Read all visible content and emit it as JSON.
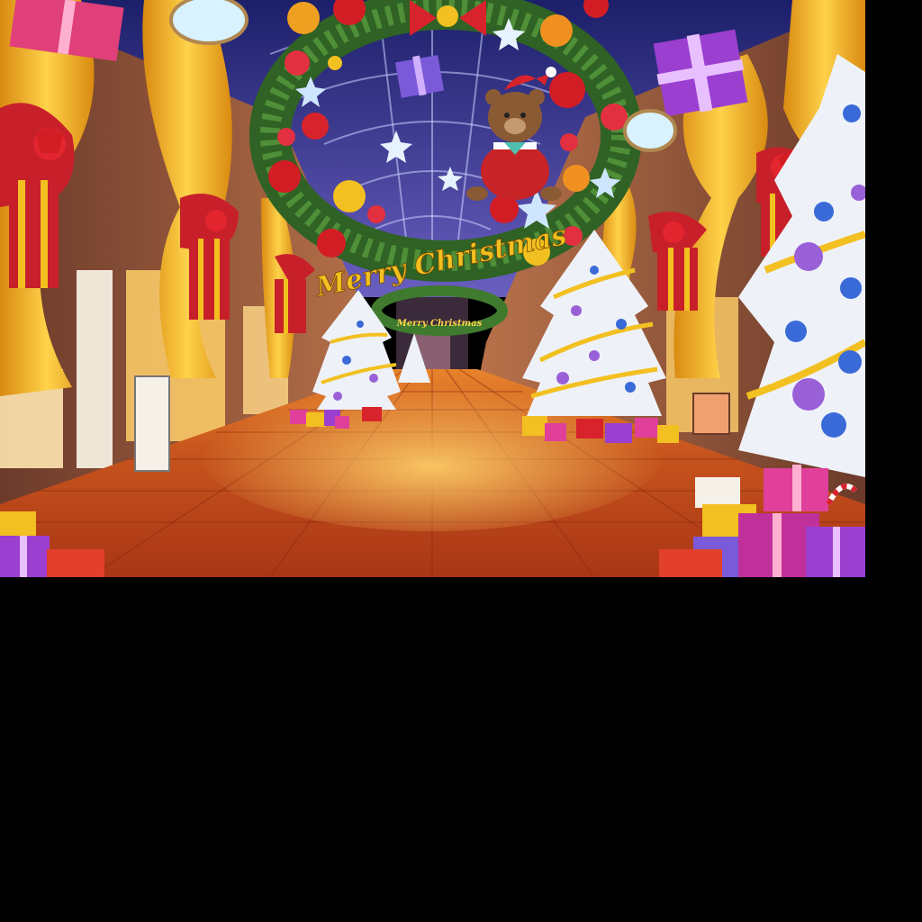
{
  "scene": {
    "banner_text": "Merry Christmas",
    "small_banner_text": "Merry Christmas"
  },
  "colors": {
    "floor": "#c4501d",
    "wreath_green": "#3f7a2e",
    "curtain_gold": "#f2b321",
    "ribbon_red": "#c8202a",
    "tree_white": "#eef2f8",
    "ceiling_blue": "#3a3f9a",
    "gift_purple": "#9b3fd0",
    "gift_pink": "#e0409a",
    "glow_yellow": "#ffd55a"
  }
}
